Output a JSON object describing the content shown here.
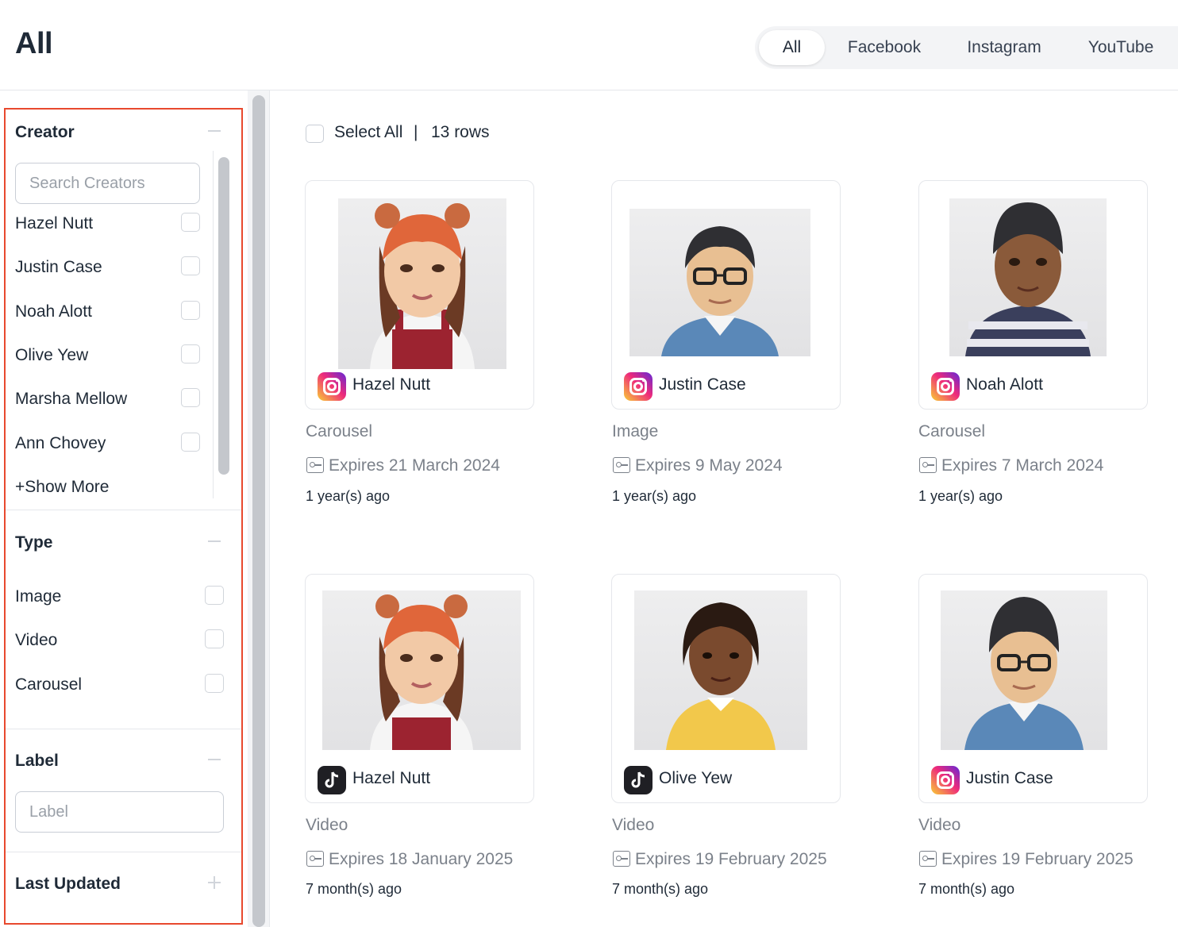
{
  "header": {
    "title": "All",
    "tabs": [
      {
        "label": "All",
        "active": true
      },
      {
        "label": "Facebook",
        "active": false
      },
      {
        "label": "Instagram",
        "active": false
      },
      {
        "label": "YouTube",
        "active": false
      }
    ]
  },
  "sidebar": {
    "creator": {
      "title": "Creator",
      "search_placeholder": "Search Creators",
      "items": [
        "Hazel Nutt",
        "Justin Case",
        "Noah Alott",
        "Olive Yew",
        "Marsha Mellow",
        "Ann Chovey"
      ],
      "show_more": "+Show More"
    },
    "type": {
      "title": "Type",
      "items": [
        "Image",
        "Video",
        "Carousel"
      ]
    },
    "label": {
      "title": "Label",
      "placeholder": "Label"
    },
    "last_updated": {
      "title": "Last Updated"
    }
  },
  "content": {
    "select_all": "Select All",
    "separator": "|",
    "rows": "13 rows",
    "cards": [
      {
        "creator": "Hazel Nutt",
        "platform": "instagram",
        "type": "Carousel",
        "expires": "Expires 21 March 2024",
        "ago": "1 year(s) ago"
      },
      {
        "creator": "Justin Case",
        "platform": "instagram",
        "type": "Image",
        "expires": "Expires 9 May 2024",
        "ago": "1 year(s) ago"
      },
      {
        "creator": "Noah Alott",
        "platform": "instagram",
        "type": "Carousel",
        "expires": "Expires 7 March 2024",
        "ago": "1 year(s) ago"
      },
      {
        "creator": "Hazel Nutt",
        "platform": "tiktok",
        "type": "Video",
        "expires": "Expires 18 January 2025",
        "ago": "7 month(s) ago"
      },
      {
        "creator": "Olive Yew",
        "platform": "tiktok",
        "type": "Video",
        "expires": "Expires 19 February 2025",
        "ago": "7 month(s) ago"
      },
      {
        "creator": "Justin Case",
        "platform": "instagram",
        "type": "Video",
        "expires": "Expires 19 February 2025",
        "ago": "7 month(s) ago"
      }
    ]
  },
  "colors": {
    "highlight_border": "#e8492e",
    "text_primary": "#1f2a37",
    "text_muted": "#7b818a"
  }
}
